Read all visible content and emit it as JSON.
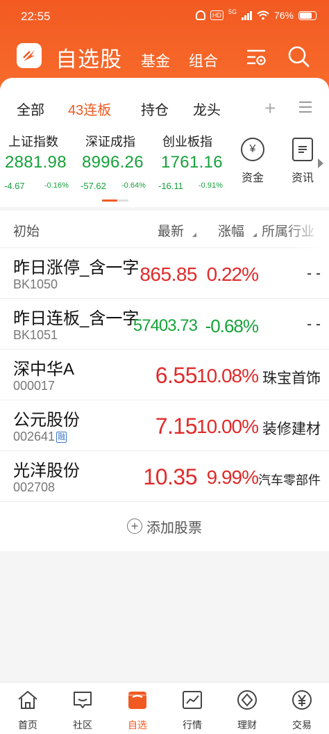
{
  "status": {
    "time": "22:55",
    "battery": "76%",
    "net": "5G",
    "hd": "HD"
  },
  "nav": {
    "main": "自选股",
    "fund": "基金",
    "combo": "组合"
  },
  "tabs": [
    "全部",
    "43连板",
    "持仓",
    "龙头"
  ],
  "indices": [
    {
      "name": "上证指数",
      "value": "2881.98",
      "change": "-4.67",
      "pct": "-0.16%"
    },
    {
      "name": "深证成指",
      "value": "8996.26",
      "change": "-57.62",
      "pct": "-0.64%"
    },
    {
      "name": "创业板指",
      "value": "1761.16",
      "change": "-16.11",
      "pct": "-0.91%"
    }
  ],
  "quick": {
    "funds": "资金",
    "news": "资讯",
    "funds_glyph": "¥"
  },
  "list_head": {
    "init": "初始",
    "price": "最新",
    "pct": "涨幅",
    "industry": "所属行业"
  },
  "rows": [
    {
      "name": "昨日涨停_含一字",
      "code": "BK1050",
      "price": "865.85",
      "pct": "0.22%",
      "industry": "- -",
      "color": "#e02a2a"
    },
    {
      "name": "昨日连板_含一字",
      "code": "BK1051",
      "price": "57403.73",
      "pct": "-0.68%",
      "industry": "- -",
      "color": "#17a33b"
    },
    {
      "name": "深中华A",
      "code": "000017",
      "price": "6.55",
      "pct": "10.08%",
      "industry": "珠宝首饰",
      "color": "#e02a2a"
    },
    {
      "name": "公元股份",
      "code": "002641",
      "tag": "融",
      "price": "7.15",
      "pct": "10.00%",
      "industry": "装修建材",
      "color": "#e02a2a"
    },
    {
      "name": "光洋股份",
      "code": "002708",
      "price": "10.35",
      "pct": "9.99%",
      "industry": "汽车零部件",
      "color": "#e02a2a"
    }
  ],
  "add_stock": "添加股票",
  "bottom": [
    "首页",
    "社区",
    "自选",
    "行情",
    "理财",
    "交易"
  ],
  "colors": {
    "accent": "#f05a22",
    "up": "#e02a2a",
    "down": "#17a33b"
  }
}
